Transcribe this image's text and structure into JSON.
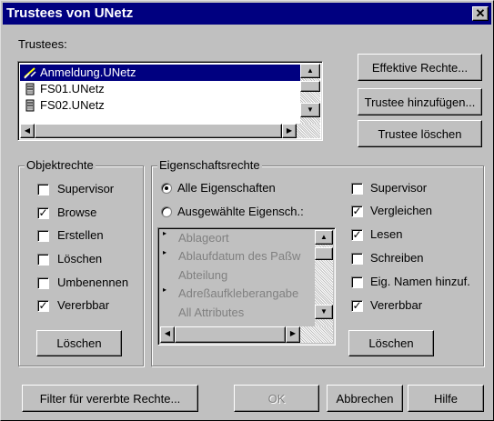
{
  "window": {
    "title": "Trustees von UNetz",
    "close_glyph": "✕"
  },
  "trustees": {
    "label": "Trustees:",
    "items": [
      {
        "name": "Anmeldung.UNetz",
        "icon": "login-script-icon",
        "selected": true
      },
      {
        "name": "FS01.UNetz",
        "icon": "server-icon",
        "selected": false
      },
      {
        "name": "FS02.UNetz",
        "icon": "server-icon",
        "selected": false
      }
    ]
  },
  "buttons": {
    "effective_rights": "Effektive Rechte...",
    "add_trustee": "Trustee hinzufügen...",
    "delete_trustee": "Trustee löschen",
    "obj_delete": "Löschen",
    "prop_delete": "Löschen",
    "inherited_filter": "Filter für vererbte Rechte...",
    "ok": "OK",
    "cancel": "Abbrechen",
    "help": "Hilfe"
  },
  "object_rights": {
    "title": "Objektrechte",
    "items": [
      {
        "label": "Supervisor",
        "checked": false
      },
      {
        "label": "Browse",
        "checked": true
      },
      {
        "label": "Erstellen",
        "checked": false
      },
      {
        "label": "Löschen",
        "checked": false
      },
      {
        "label": "Umbenennen",
        "checked": false
      },
      {
        "label": "Vererbbar",
        "checked": true
      }
    ]
  },
  "property_rights": {
    "title": "Eigenschaftsrechte",
    "radio_all": "Alle Eigenschaften",
    "radio_selected": "Ausgewählte Eigensch.:",
    "radio_all_selected": true,
    "properties": [
      "Ablageort",
      "Ablaufdatum des Paßw",
      "Abteilung",
      "Adreßaufkleberangabe",
      "All Attributes"
    ],
    "rights": [
      {
        "label": "Supervisor",
        "checked": false
      },
      {
        "label": "Vergleichen",
        "checked": true
      },
      {
        "label": "Lesen",
        "checked": true
      },
      {
        "label": "Schreiben",
        "checked": false
      },
      {
        "label": "Eig. Namen hinzuf.",
        "checked": false
      },
      {
        "label": "Vererbbar",
        "checked": true
      }
    ]
  }
}
